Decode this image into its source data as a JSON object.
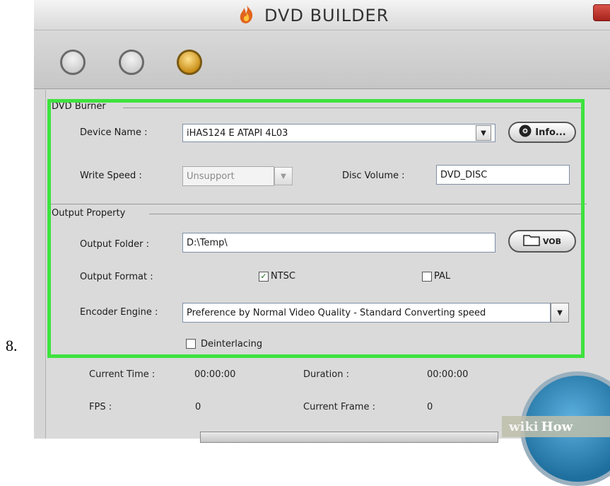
{
  "step_number": "8.",
  "window": {
    "title": "DVD BUILDER"
  },
  "dvd_burner": {
    "group_title": "DVD Burner",
    "device_name_label": "Device Name :",
    "device_name_value": "iHAS124  E    ATAPI   4L03",
    "info_button_label": "Info...",
    "write_speed_label": "Write Speed :",
    "write_speed_value": "Unsupport",
    "disc_volume_label": "Disc Volume :",
    "disc_volume_value": "DVD_DISC"
  },
  "output_property": {
    "group_title": "Output Property",
    "output_folder_label": "Output Folder :",
    "output_folder_value": "D:\\Temp\\",
    "vob_button_label": "VOB",
    "output_format_label": "Output Format :",
    "ntsc_label": "NTSC",
    "ntsc_checked": true,
    "pal_label": "PAL",
    "pal_checked": false,
    "encoder_engine_label": "Encoder Engine :",
    "encoder_engine_value": "Preference by Normal Video Quality - Standard Converting speed",
    "deinterlacing_label": "Deinterlacing",
    "deinterlacing_checked": false
  },
  "status": {
    "current_time_label": "Current Time :",
    "current_time_value": "00:00:00",
    "duration_label": "Duration :",
    "duration_value": "00:00:00",
    "fps_label": "FPS :",
    "fps_value": "0",
    "current_frame_label": "Current Frame :",
    "current_frame_value": "0"
  },
  "watermark": {
    "part1": "wiki",
    "part2": "How"
  },
  "colors": {
    "highlight_border": "#3ee23e",
    "active_step_circle": "#c68a12"
  }
}
